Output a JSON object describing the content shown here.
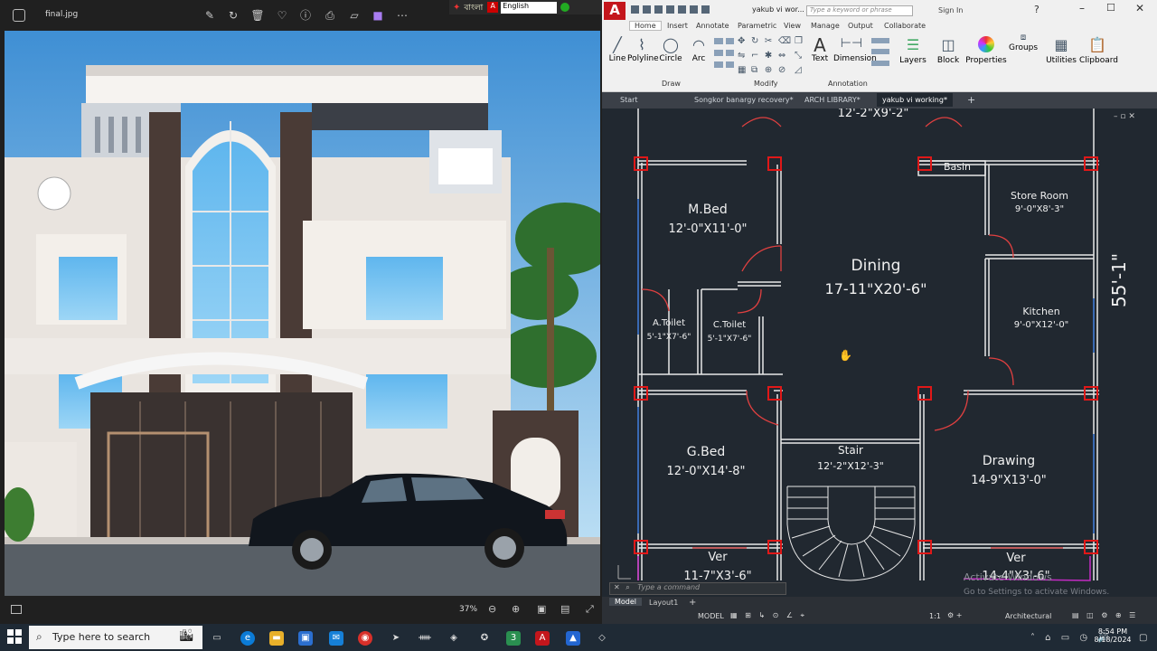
{
  "viewer": {
    "file_name": "final.jpg",
    "zoom": "37%",
    "language_label": "বাংলা",
    "language_select": "English"
  },
  "cad": {
    "app_letter": "A",
    "window_title": "yakub vi wor...",
    "search_placeholder": "Type a keyword or phrase",
    "sign_in": "Sign In",
    "ribbon_tabs": [
      "Home",
      "Insert",
      "Annotate",
      "Parametric",
      "View",
      "Manage",
      "Output",
      "Collaborate"
    ],
    "draw_tools": [
      "Line",
      "Polyline",
      "Circle",
      "Arc"
    ],
    "panel_draw": "Draw",
    "panel_modify": "Modify",
    "panel_annotation": "Annotation",
    "annotation_tools": [
      "Text",
      "Dimension"
    ],
    "right_tools": [
      "Layers",
      "Block",
      "Properties",
      "Groups",
      "Utilities",
      "Clipboard"
    ],
    "doc_tabs": [
      "Start",
      "Songkor banargy recovery*",
      "ARCH LIBRARY*",
      "yakub vi working*"
    ],
    "command_placeholder": "Type a command",
    "layout_tabs": [
      "Model",
      "Layout1"
    ],
    "status_model": "MODEL",
    "status_scale": "1:1",
    "status_workspace": "Architectural",
    "rooms": {
      "top_dim": "12'-2\"X9'-2\"",
      "basin": "Basin",
      "mbed_name": "M.Bed",
      "mbed_dim": "12'-0\"X11'-0\"",
      "store_name": "Store Room",
      "store_dim": "9'-0\"X8'-3\"",
      "dining_name": "Dining",
      "dining_dim": "17-11\"X20'-6\"",
      "kitchen_name": "Kitchen",
      "kitchen_dim": "9'-0\"X12'-0\"",
      "atoilet_name": "A.Toilet",
      "atoilet_dim": "5'-1\"X7'-6\"",
      "ctoilet_name": "C.Toilet",
      "ctoilet_dim": "5'-1\"X7'-6\"",
      "gbed_name": "G.Bed",
      "gbed_dim": "12'-0\"X14'-8\"",
      "stair_name": "Stair",
      "stair_dim": "12'-2\"X12'-3\"",
      "drawing_name": "Drawing",
      "drawing_dim": "14-9\"X13'-0\"",
      "ver1_name": "Ver",
      "ver1_dim": "11-7\"X3'-6\"",
      "ver2_name": "Ver",
      "ver2_dim": "14-4\"X3'-6\"",
      "side_dim": "55'-1\""
    },
    "watermark_title": "Activate Windows",
    "watermark_sub": "Go to Settings to activate Windows."
  },
  "taskbar": {
    "search_placeholder": "Type here to search",
    "time": "8:54 PM",
    "date": "8/18/2024"
  },
  "colors": {
    "cad_bg": "#212830",
    "wall": "#e8e8e8",
    "column": "#e01818",
    "door": "#e04040"
  }
}
